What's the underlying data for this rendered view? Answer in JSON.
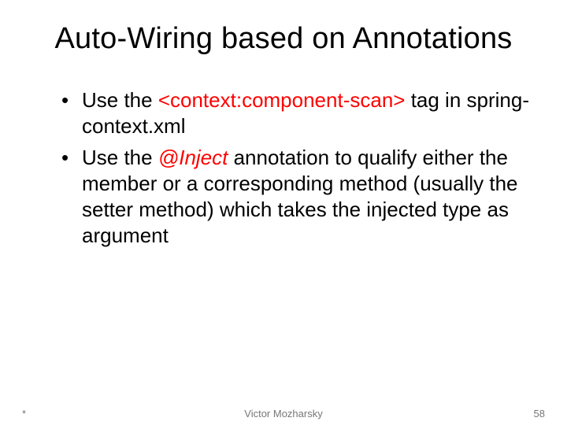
{
  "title": "Auto-Wiring based on Annotations",
  "bullets": [
    {
      "pre": "Use the ",
      "hl": "<context:component-scan>",
      "hl_italic": false,
      "post": " tag in spring-context.xml"
    },
    {
      "pre": "Use the ",
      "hl": "@Inject",
      "hl_italic": true,
      "post": " annotation to qualify either the member or a corresponding method (usually the setter method) which takes the injected type as argument"
    }
  ],
  "footer": {
    "left": "*",
    "center": "Victor Mozharsky",
    "right": "58"
  }
}
